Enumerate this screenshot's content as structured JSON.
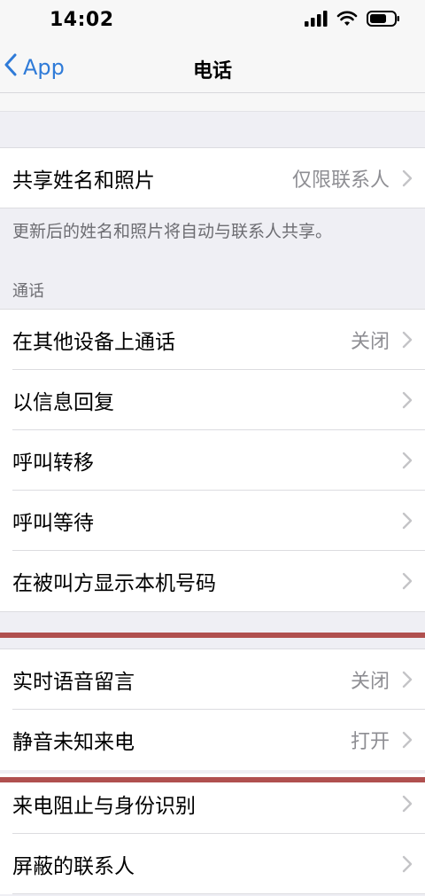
{
  "status_bar": {
    "time": "14:02"
  },
  "nav": {
    "back_label": "App",
    "title": "电话"
  },
  "sharing": {
    "label": "共享姓名和照片",
    "value": "仅限联系人",
    "note": "更新后的姓名和照片将自动与联系人共享。"
  },
  "calls_section": {
    "header": "通话",
    "items": [
      {
        "label": "在其他设备上通话",
        "value": "关闭"
      },
      {
        "label": "以信息回复",
        "value": ""
      },
      {
        "label": "呼叫转移",
        "value": ""
      },
      {
        "label": "呼叫等待",
        "value": ""
      },
      {
        "label": "在被叫方显示本机号码",
        "value": ""
      }
    ]
  },
  "second_section": {
    "items": [
      {
        "label": "实时语音留言",
        "value": "关闭"
      },
      {
        "label": "静音未知来电",
        "value": "打开"
      },
      {
        "label": "来电阻止与身份识别",
        "value": ""
      },
      {
        "label": "屏蔽的联系人",
        "value": ""
      }
    ]
  },
  "colors": {
    "accent": "#2f7bd8",
    "annotation_red": "#b0504f",
    "background": "#efeff4"
  }
}
